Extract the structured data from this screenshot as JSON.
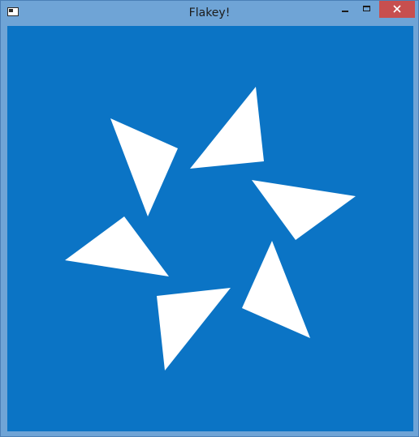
{
  "window": {
    "title": "Flakey!",
    "colors": {
      "frame": "#6fa4d6",
      "client_background": "#0b74c5",
      "flake": "#ffffff",
      "close_button": "#c74f4f"
    },
    "icons": {
      "app": "app-window-icon",
      "minimize": "minimize-icon",
      "maximize": "maximize-icon",
      "close": "close-icon"
    }
  }
}
